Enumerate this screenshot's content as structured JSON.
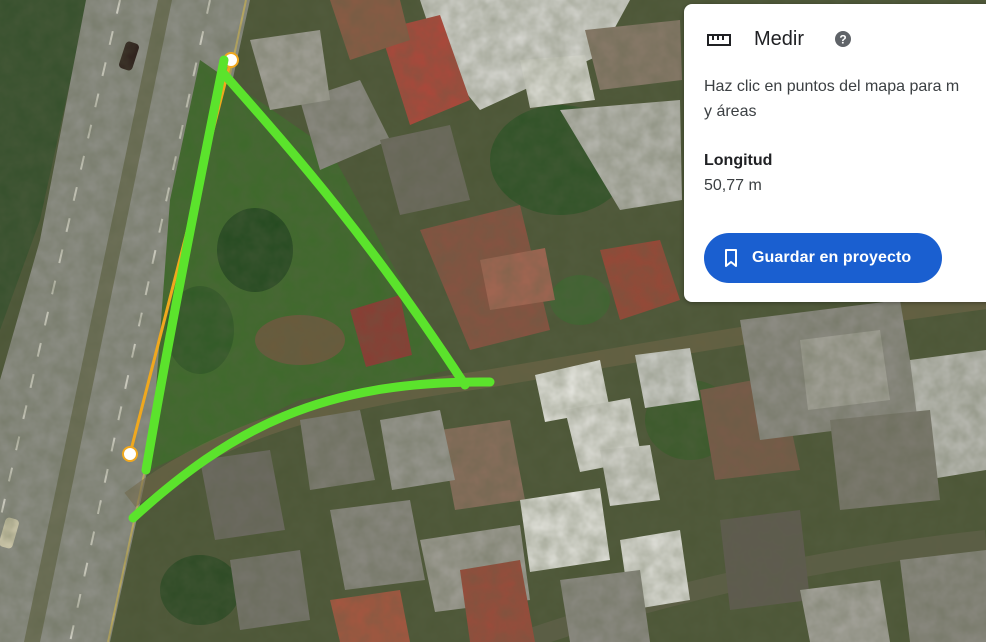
{
  "panel": {
    "title": "Medir",
    "description": "Haz clic en puntos del mapa para m\ny áreas",
    "measure_label": "Longitud",
    "measure_value": "50,77 m",
    "save_label": "Guardar en proyecto"
  },
  "colors": {
    "accent": "#1a5fd0",
    "drawn_shape": "#5be32c",
    "measure_line": "#f0a81e"
  },
  "icons": [
    "ruler-icon",
    "help-icon",
    "bookmark-icon"
  ]
}
